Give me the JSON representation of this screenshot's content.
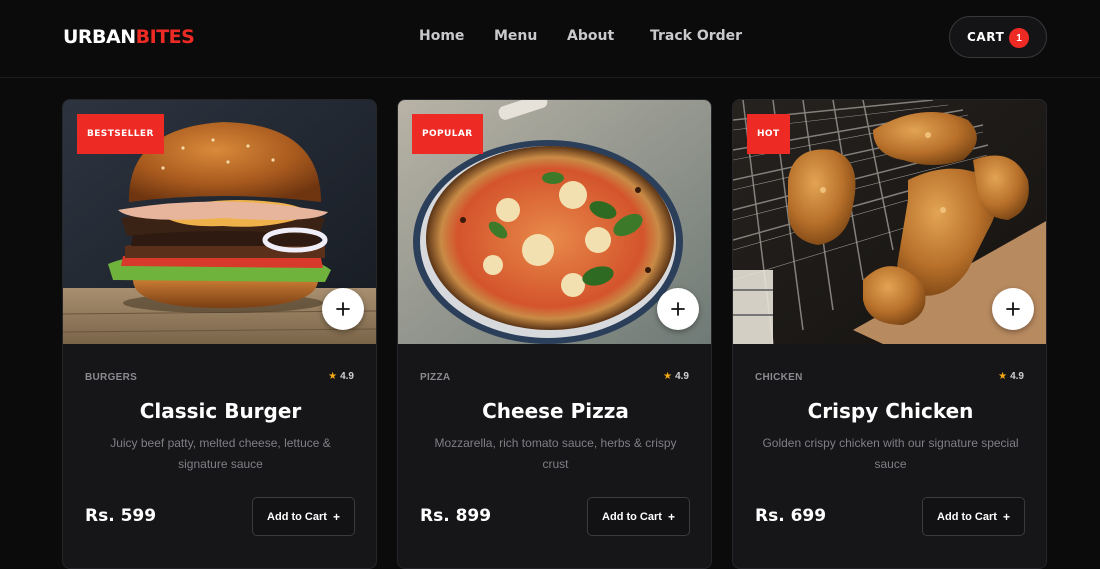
{
  "brand": {
    "part1": "URBAN",
    "part2": "BITES"
  },
  "nav": {
    "links": [
      "Home",
      "Menu",
      "About",
      "Track Order"
    ]
  },
  "cart": {
    "label": "CART",
    "count": "1"
  },
  "colors": {
    "accent": "#ee2a24",
    "star": "#f4a814",
    "background": "#0b0b0c",
    "card": "#161618"
  },
  "icons": {
    "plus": "plus-icon",
    "star": "star-icon"
  },
  "products": [
    {
      "badge": "BESTSELLER",
      "category": "BURGERS",
      "rating": "4.9",
      "name": "Classic Burger",
      "description": "Juicy beef patty, melted cheese, lettuce & signature sauce",
      "price": "Rs. 599",
      "button": "Add to Cart"
    },
    {
      "badge": "POPULAR",
      "category": "PIZZA",
      "rating": "4.9",
      "name": "Cheese Pizza",
      "description": "Mozzarella, rich tomato sauce, herbs & crispy crust",
      "price": "Rs. 899",
      "button": "Add to Cart"
    },
    {
      "badge": "HOT",
      "category": "CHICKEN",
      "rating": "4.9",
      "name": "Crispy Chicken",
      "description": "Golden crispy chicken with our signature special sauce",
      "price": "Rs. 699",
      "button": "Add to Cart"
    }
  ]
}
